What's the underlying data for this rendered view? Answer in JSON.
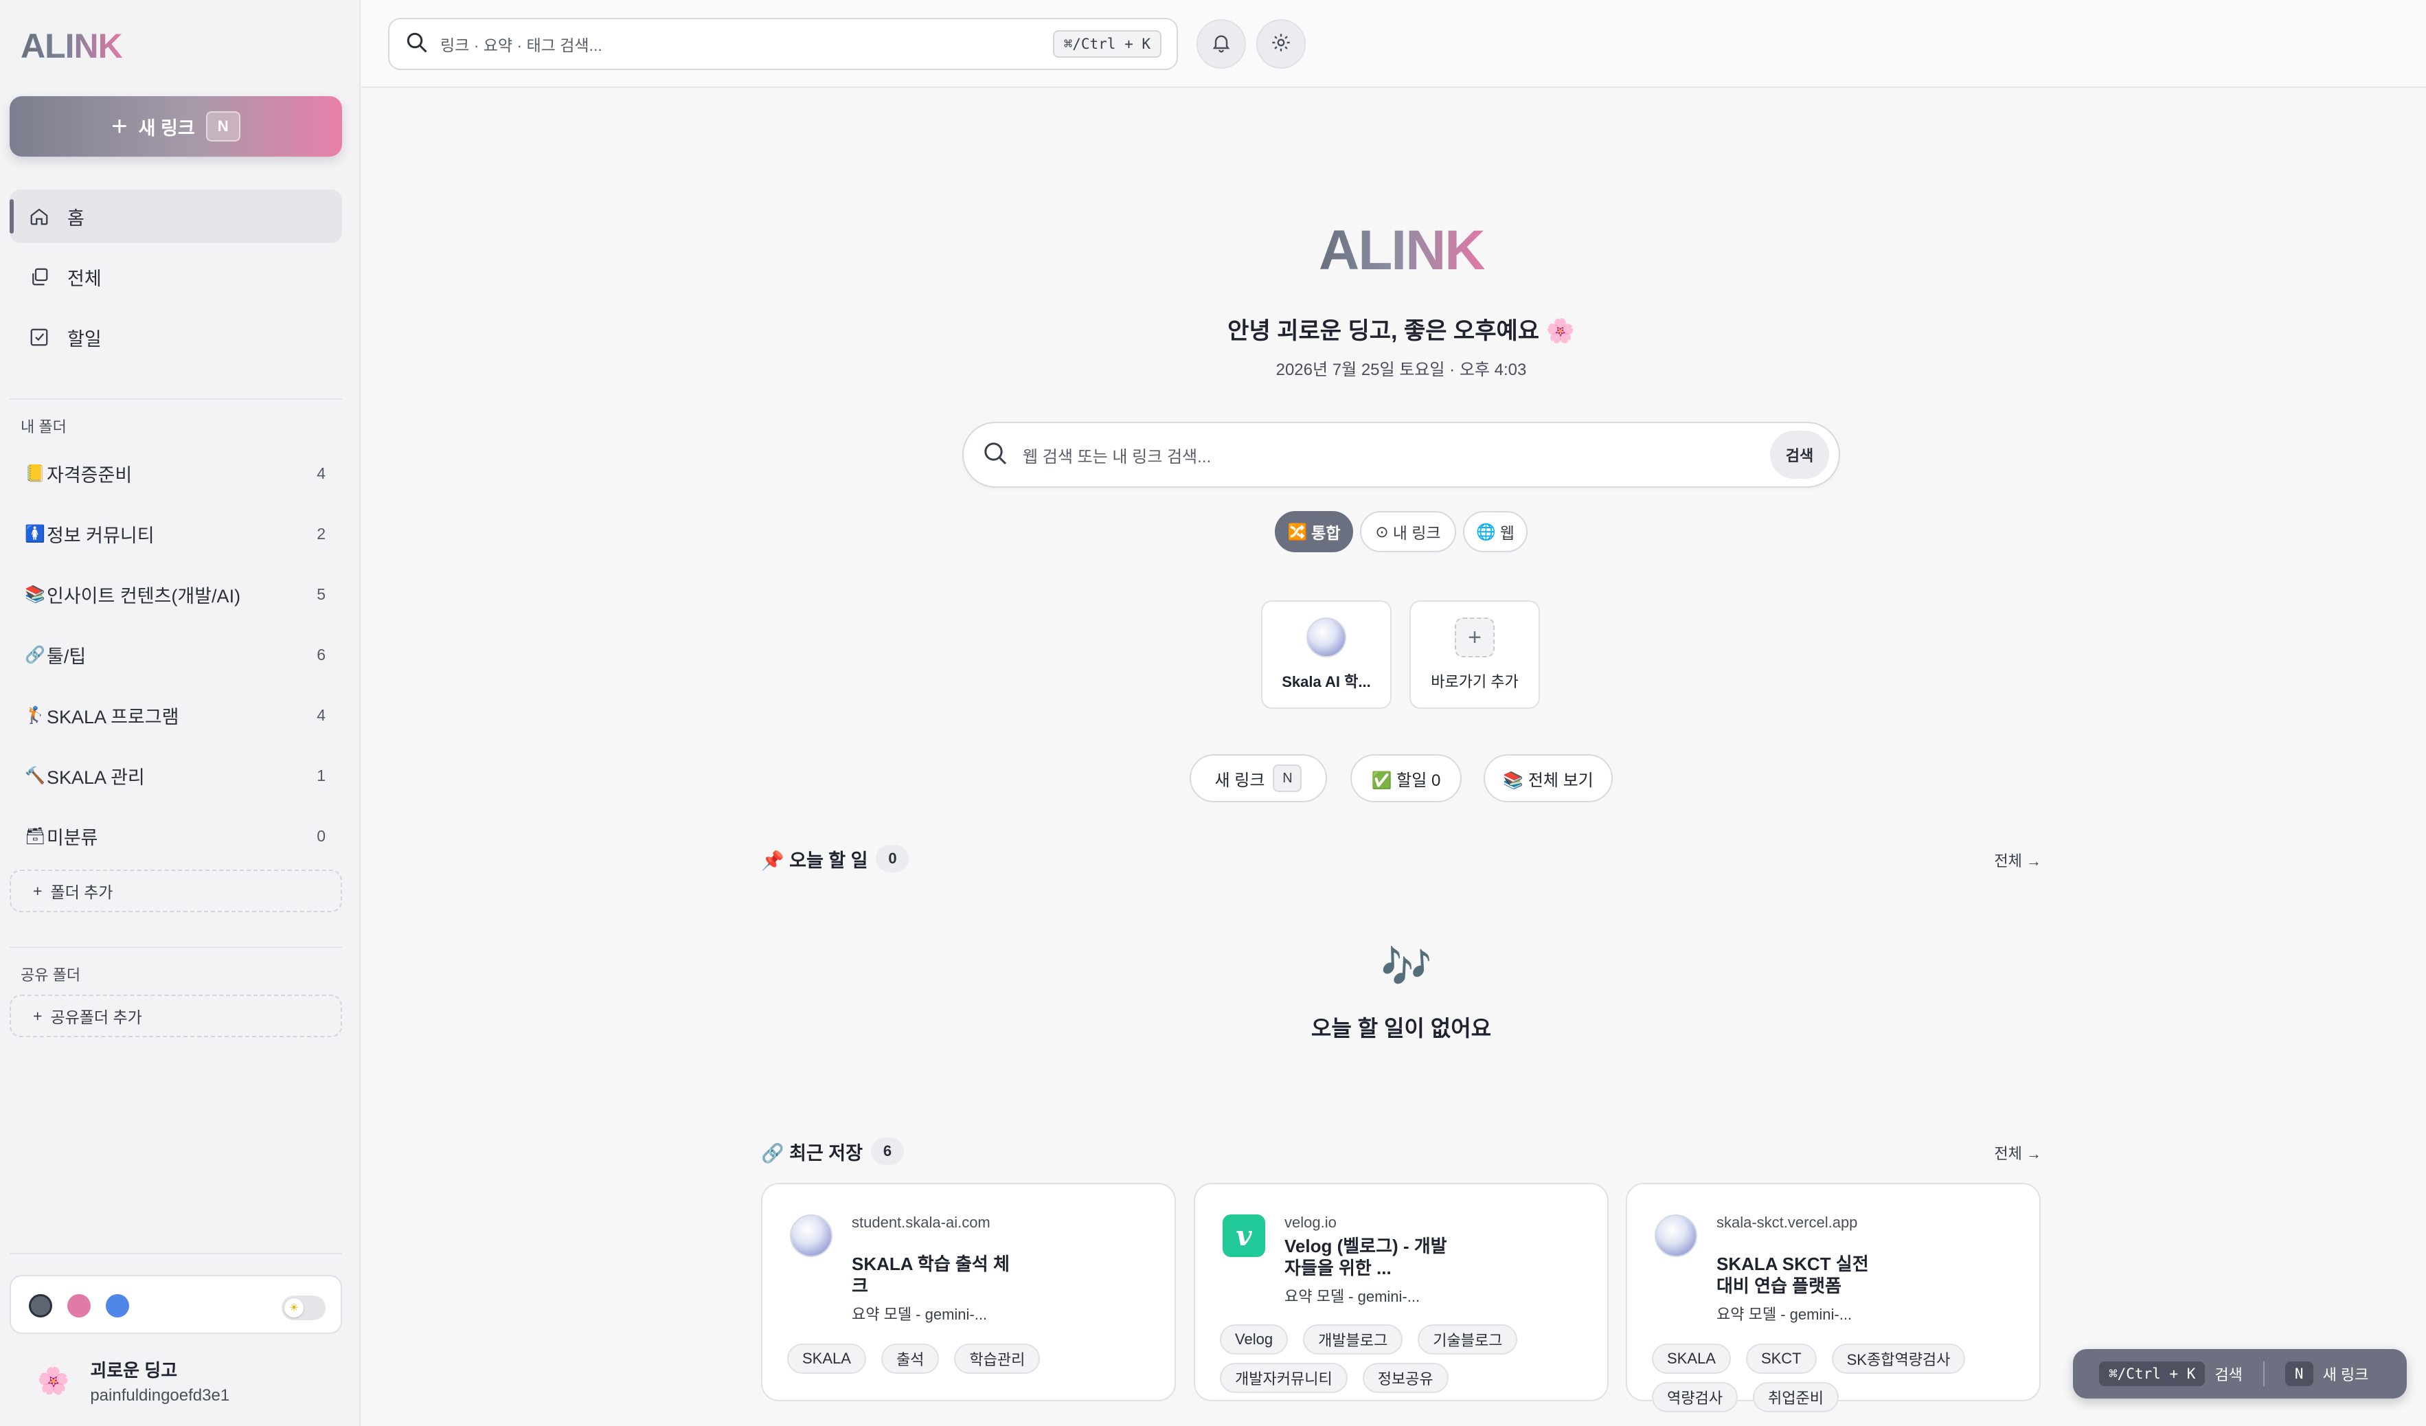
{
  "app": {
    "logo": "ALINK"
  },
  "sidebar": {
    "new_link_label": "새 링크",
    "new_link_shortcut": "N",
    "nav": [
      {
        "label": "홈",
        "icon": "home-icon",
        "active": true
      },
      {
        "label": "전체",
        "icon": "copy-icon",
        "active": false
      },
      {
        "label": "할일",
        "icon": "checkbox-icon",
        "active": false
      }
    ],
    "my_folders_label": "내 폴더",
    "folders": [
      {
        "emoji": "📒",
        "name": "자격증준비",
        "count": "4"
      },
      {
        "emoji": "🚺",
        "name": "정보 커뮤니티",
        "count": "2"
      },
      {
        "emoji": "📚",
        "name": "인사이트 컨텐츠(개발/AI)",
        "count": "5"
      },
      {
        "emoji": "🔗",
        "name": "툴/팁",
        "count": "6"
      },
      {
        "emoji": "🏌",
        "name": "SKALA 프로그램",
        "count": "4"
      },
      {
        "emoji": "🔨",
        "name": "SKALA 관리",
        "count": "1"
      },
      {
        "emoji": "🗃",
        "name": "미분류",
        "count": "0"
      }
    ],
    "add_folder_label": "폴더 추가",
    "shared_folders_label": "공유 폴더",
    "add_shared_folder_label": "공유폴더 추가",
    "theme_colors": [
      "#5f6472",
      "#e07aa7",
      "#4f86e8"
    ],
    "profile": {
      "avatar": "🌸",
      "name": "괴로운 딩고",
      "id": "painfuldingoefd3e1"
    }
  },
  "topbar": {
    "search_placeholder": "링크 · 요약 · 태그 검색...",
    "search_shortcut": "⌘/Ctrl + K"
  },
  "main": {
    "logo": "ALINK",
    "greeting": "안녕 괴로운 딩고, 좋은 오후예요 🌸",
    "datetime": "2026년 7월 25일 토요일 · 오후 4:03",
    "search_placeholder": "웹 검색 또는 내 링크 검색...",
    "search_button": "검색",
    "search_modes": [
      {
        "label": "통합",
        "icon": "🔀",
        "active": true
      },
      {
        "label": "내 링크",
        "icon": "⊙",
        "active": false
      },
      {
        "label": "웹",
        "icon": "🌐",
        "active": false
      }
    ],
    "shortcuts": [
      {
        "label": "Skala AI 학..."
      },
      {
        "label": "바로가기 추가",
        "add_icon": "+"
      }
    ],
    "quick_actions": {
      "new_link": "새 링크",
      "new_link_key": "N",
      "todo": "✅ 할일 0",
      "view_all": "📚 전체 보기"
    },
    "today_todo": {
      "title": "📌 오늘 할 일",
      "count": "0",
      "see_all": "전체 →",
      "empty_icon": "🎶",
      "empty_text": "오늘 할 일이 없어요"
    },
    "recent": {
      "title": "🔗 최근 저장",
      "count": "6",
      "see_all": "전체 →",
      "cards": [
        {
          "domain": "student.skala-ai.com",
          "title": "SKALA 학습 출석 체크",
          "model": "요약 모델 - gemini-...",
          "favicon": "globe-icon",
          "tags": [
            "SKALA",
            "출석",
            "학습관리"
          ]
        },
        {
          "domain": "velog.io",
          "title": "Velog (벨로그) - 개발자들을 위한 ...",
          "model": "요약 모델 - gemini-...",
          "favicon": "velog-icon",
          "favicon_letter": "v",
          "tags": [
            "Velog",
            "개발블로그",
            "기술블로그",
            "개발자커뮤니티",
            "정보공유"
          ]
        },
        {
          "domain": "skala-skct.vercel.app",
          "title": "SKALA SKCT 실전 대비 연습 플랫폼",
          "model": "요약 모델 - gemini-...",
          "favicon": "globe-icon",
          "tags": [
            "SKALA",
            "SKCT",
            "SK종합역량검사",
            "역량검사",
            "취업준비"
          ]
        }
      ]
    }
  },
  "floating_hint": {
    "search_key": "⌘/Ctrl + K",
    "search_label": "검색",
    "new_key": "N",
    "new_label": "새 링크"
  }
}
